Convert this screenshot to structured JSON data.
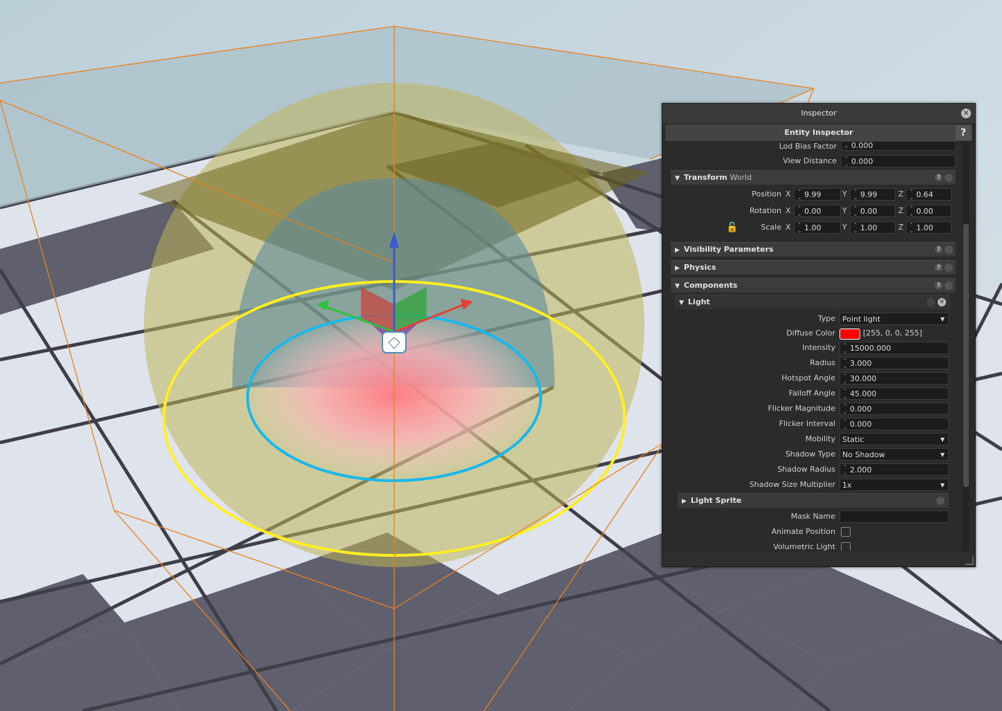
{
  "inspector": {
    "title": "Inspector",
    "close_icon": "close-icon",
    "subtitle": "Entity Inspector",
    "help_label": "?",
    "props_top": [
      {
        "label": "Lod Bias Factor",
        "value": "0.000"
      },
      {
        "label": "View Distance",
        "value": "0.000"
      }
    ],
    "transform": {
      "title": "Transform",
      "title_suffix": "World",
      "axes": [
        "X",
        "Y",
        "Z"
      ],
      "position_label": "Position",
      "position": [
        "9.99",
        "9.99",
        "0.64"
      ],
      "rotation_label": "Rotation",
      "rotation": [
        "0.00",
        "0.00",
        "0.00"
      ],
      "scale_label": "Scale",
      "scale": [
        "1.00",
        "1.00",
        "1.00"
      ],
      "lock_icon": "unlocked-padlock-icon"
    },
    "sections": {
      "visibility": "Visibility Parameters",
      "physics": "Physics",
      "components": "Components"
    },
    "help_glyph": "?",
    "light": {
      "title": "Light",
      "type_label": "Type",
      "type_value": "Point light",
      "diffuse_label": "Diffuse Color",
      "diffuse_value": "[255, 0, 0, 255]",
      "diffuse_swatch": "#ff0000",
      "intensity_label": "Intensity",
      "intensity": "15000.000",
      "radius_label": "Radius",
      "radius": "3.000",
      "hotspot_label": "Hotspot Angle",
      "hotspot": "30.000",
      "falloff_label": "Falloff Angle",
      "falloff": "45.000",
      "flicker_mag_label": "Flicker Magnitude",
      "flicker_mag": "0.000",
      "flicker_int_label": "Flicker Interval",
      "flicker_int": "0.000",
      "mobility_label": "Mobility",
      "mobility": "Static",
      "shadow_type_label": "Shadow Type",
      "shadow_type": "No Shadow",
      "shadow_radius_label": "Shadow Radius",
      "shadow_radius": "2.000",
      "shadow_size_label": "Shadow Size Multiplier",
      "shadow_size": "1x"
    },
    "light_sprite": {
      "title": "Light Sprite",
      "mask_label": "Mask Name",
      "mask_value": "",
      "animate_label": "Animate Position",
      "volumetric_label": "Volumetric Light"
    }
  }
}
